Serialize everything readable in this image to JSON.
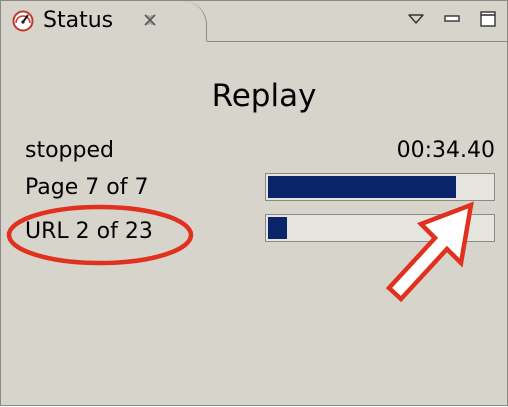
{
  "tab": {
    "title": "Status",
    "icon": "speedometer-icon",
    "close_icon": "close-tab-icon"
  },
  "view_controls": [
    "view-menu-icon",
    "minimize-icon",
    "maximize-icon"
  ],
  "replay": {
    "heading": "Replay",
    "state": "stopped",
    "elapsed": "00:34.40",
    "page_label": "Page 7 of 7",
    "page_progress": 0.84,
    "url_label": "URL 2 of 23",
    "url_progress": 0.087
  },
  "colors": {
    "panel_background": "#d7d4cc",
    "progress_fill": "#0a246a",
    "annotation": "#e0301e"
  }
}
